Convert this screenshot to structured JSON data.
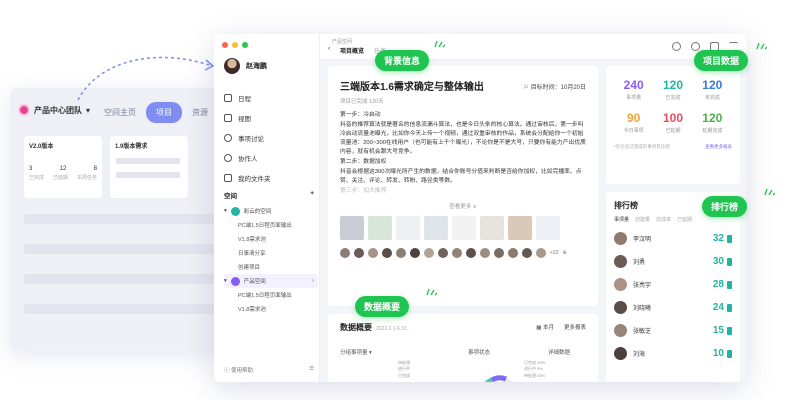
{
  "bg": {
    "team": "产品中心团队",
    "tabs": [
      "空间主页",
      "项目",
      "资源"
    ],
    "cards": [
      {
        "title": "V2.0版本",
        "nums": [
          "3",
          "12",
          "8"
        ],
        "labels": [
          "已完成",
          "已延期",
          "本周任务"
        ]
      },
      {
        "title": "1.9版本需求"
      }
    ]
  },
  "sidebar": {
    "user": "赵海鹏",
    "nav": [
      "日程",
      "视图",
      "事项讨论",
      "协作人",
      "我的文件夹"
    ],
    "space_title": "空间",
    "space_add": "+",
    "spaces": [
      {
        "label": "彩云的空间",
        "color": "#27b1a3",
        "level": "top"
      },
      {
        "label": "PC端1.5日程页面输出",
        "level": "sub"
      },
      {
        "label": "V1.8需求池",
        "level": "sub"
      },
      {
        "label": "日事清分享",
        "level": "sub"
      },
      {
        "label": "创建项目",
        "level": "sub"
      },
      {
        "label": "产品空间",
        "color": "#8a5cf6",
        "level": "top",
        "highlight": true
      },
      {
        "label": "PC端1.5日程页面输出",
        "level": "sub"
      },
      {
        "label": "V1.8需求池",
        "level": "sub"
      }
    ],
    "help": "使用帮助"
  },
  "topbar": {
    "crumb": "产品空间",
    "tabs": [
      "项目概览",
      "任务"
    ]
  },
  "article": {
    "title": "三端版本1.6需求确定与整体输出",
    "deadline": "目标时间：10月20日",
    "meta": "项目已完成 120天",
    "body": [
      "第一步：冷启动",
      "抖音的推荐算法就是著名的信息流漏斗算法，也是今日头条的核心算法。通过审核后，第一步叫冷启动流量池曝光，比如你今天上传一个视频，通过双重审核的作品，系统会分配给你一个初始流量池：200~300在线用户（也可能有上千个曝光），不论你是不是大号，只要你有能力产出优质内容，就有机会跟大号竞争。",
      "第二步：数据加权",
      "抖音会根据这300次曝光所产生的数据，结合你账号分值来判断是否给你加权，比如完播率、点赞、关注、评论、转发、转粉、路径类等数。"
    ],
    "body_fade": "第三步：加大推荐",
    "expand": "查看更多 ∨",
    "more_count": "+32"
  },
  "overview": {
    "title": "数据概要",
    "date": "2022.6.1-6.31",
    "range": "本月",
    "more": "更多报表",
    "sub_left": "分组事项量",
    "sub_mid": "事项状态",
    "sub_right": "详细数据",
    "legend": [
      "待处理",
      "进行中",
      "已完成"
    ],
    "legend_pct": [
      "已完成 45%",
      "进行中 5%",
      "待处理 53%"
    ]
  },
  "stats": {
    "items": [
      {
        "value": "240",
        "label": "事项量",
        "color": "#8a5cf6"
      },
      {
        "value": "120",
        "label": "已完成",
        "color": "#1fb5a0"
      },
      {
        "value": "120",
        "label": "未完成",
        "color": "#3a7bd5"
      },
      {
        "value": "90",
        "label": "今日事项",
        "color": "#f0a63b"
      },
      {
        "value": "100",
        "label": "已延期",
        "color": "#e64b5c"
      },
      {
        "value": "120",
        "label": "延期完成",
        "color": "#4caf50"
      }
    ],
    "foot": "*仅包含已完成的事项及比例",
    "foot_link": "查看更多报表"
  },
  "rank": {
    "title": "排行榜",
    "tabs": [
      "事项量",
      "创建量",
      "完成率",
      "已延期"
    ],
    "rows": [
      {
        "name": "李汉明",
        "value": "32",
        "color": "#1fb5a0"
      },
      {
        "name": "刘勇",
        "value": "30",
        "color": "#1fb5a0"
      },
      {
        "name": "张亮宇",
        "value": "28",
        "color": "#1fb5a0"
      },
      {
        "name": "刘晓曦",
        "value": "24",
        "color": "#1fb5a0"
      },
      {
        "name": "张敏芝",
        "value": "15",
        "color": "#1fb5a0"
      },
      {
        "name": "刘海",
        "value": "10",
        "color": "#1fb5a0"
      }
    ]
  },
  "callouts": {
    "bg_info": "背景信息",
    "project_data": "项目数据",
    "leaderboard": "排行榜",
    "data_overview": "数据概要"
  }
}
